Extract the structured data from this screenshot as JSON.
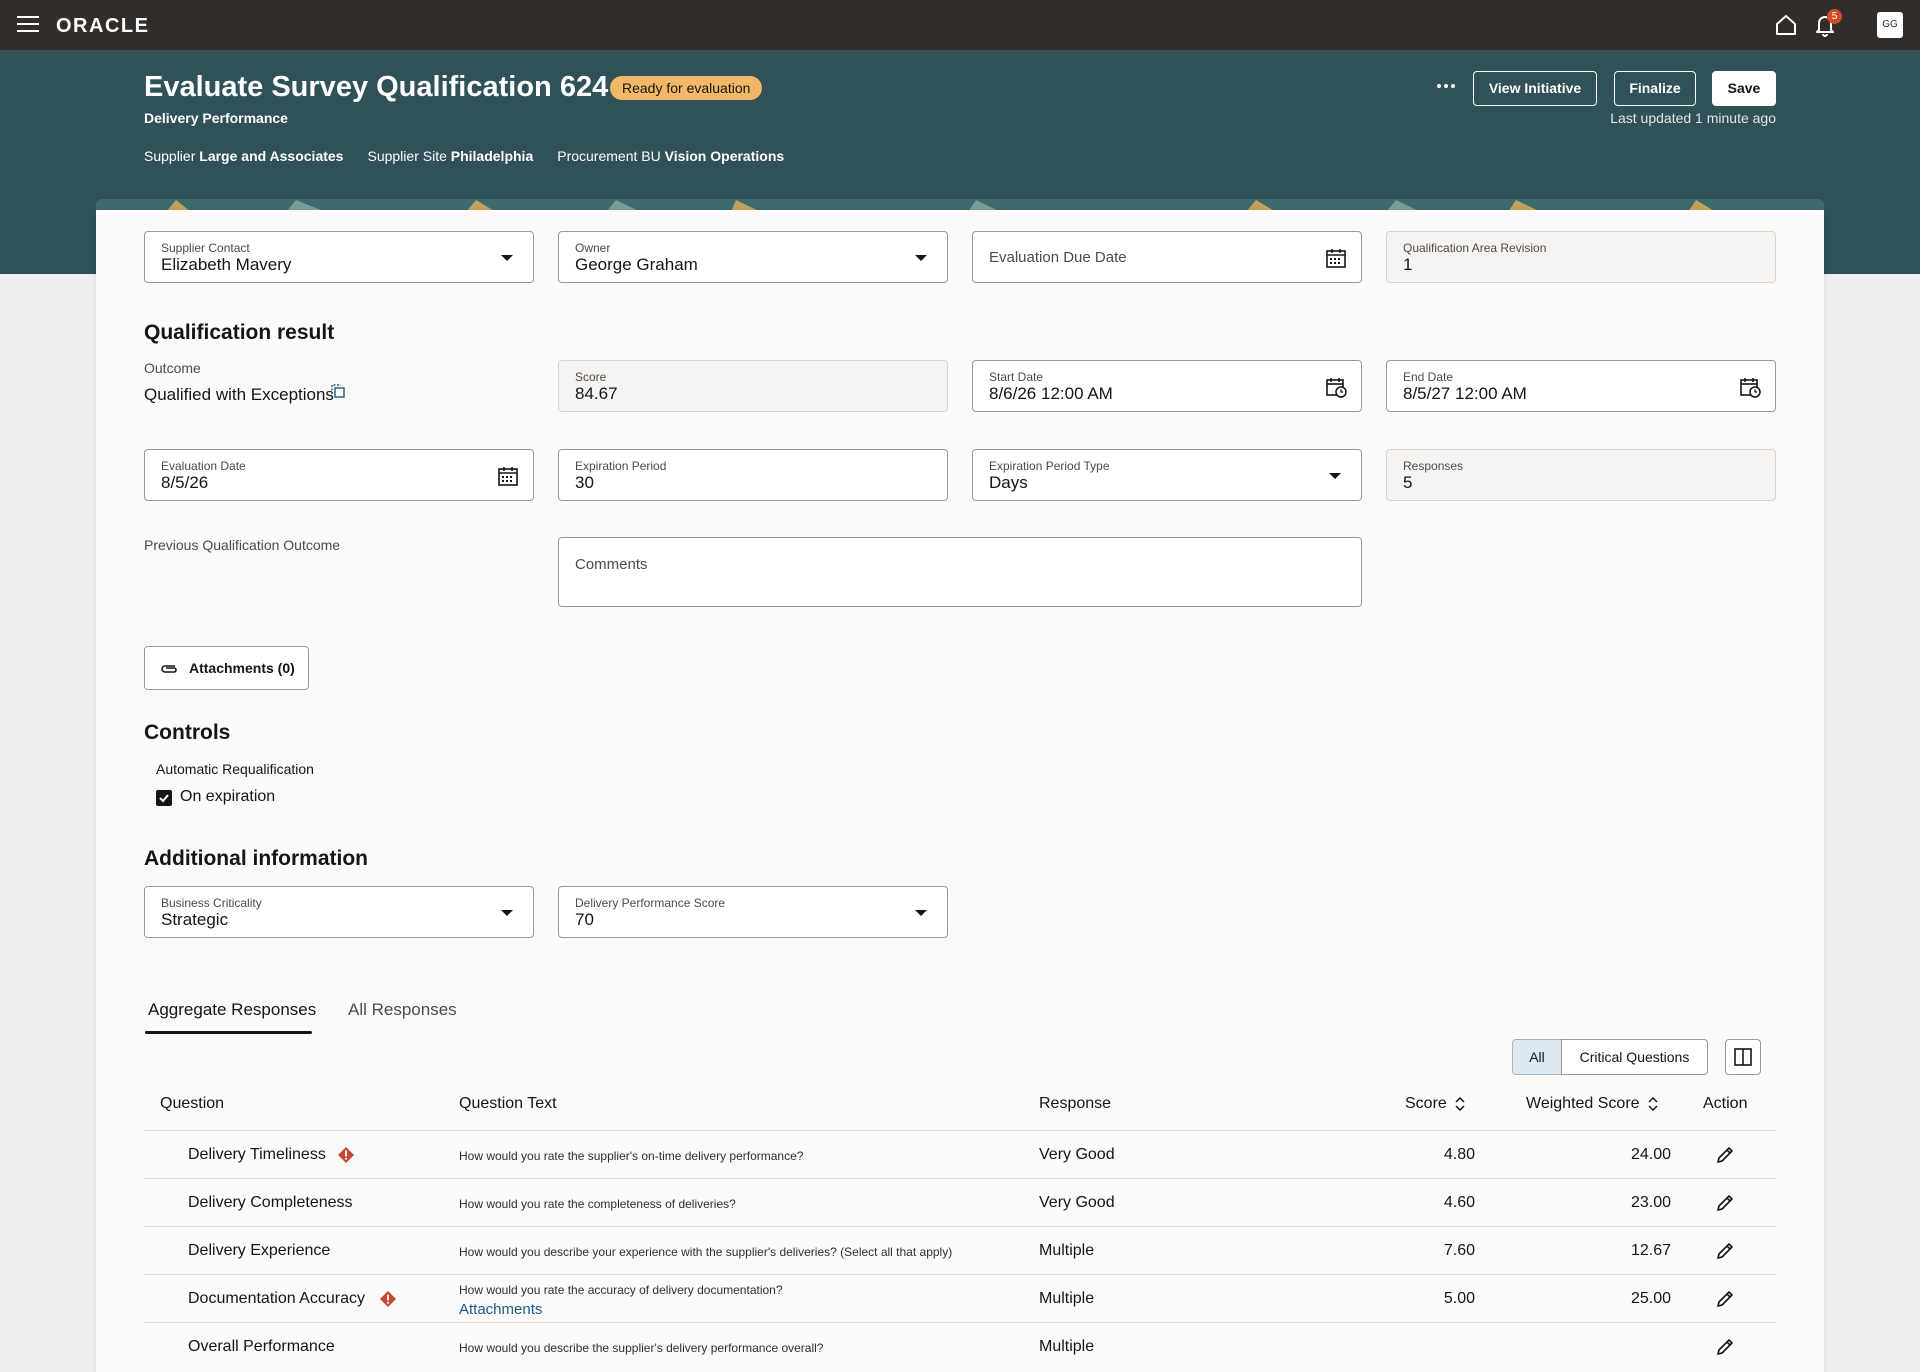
{
  "app": {
    "logo": "ORACLE",
    "notifications_count": "5",
    "user_initials": "GG"
  },
  "header": {
    "title": "Evaluate Survey Qualification 624",
    "status": "Ready for evaluation",
    "subtitle": "Delivery Performance",
    "supplier_label": "Supplier",
    "supplier_value": "Large and Associates",
    "site_label": "Supplier Site",
    "site_value": "Philadelphia",
    "bu_label": "Procurement BU",
    "bu_value": "Vision Operations",
    "view_initiative": "View Initiative",
    "finalize": "Finalize",
    "save": "Save",
    "last_updated": "Last updated 1 minute ago"
  },
  "top_fields": {
    "supplier_contact": {
      "label": "Supplier Contact",
      "value": "Elizabeth Mavery"
    },
    "owner": {
      "label": "Owner",
      "value": "George Graham"
    },
    "due_date": {
      "label": "Evaluation Due Date"
    },
    "revision": {
      "label": "Qualification Area Revision",
      "value": "1"
    }
  },
  "qualification": {
    "title": "Qualification result",
    "outcome_label": "Outcome",
    "outcome_value": "Qualified with Exceptions",
    "score": {
      "label": "Score",
      "value": "84.67"
    },
    "start_date": {
      "label": "Start Date",
      "value": "8/6/26 12:00 AM"
    },
    "end_date": {
      "label": "End Date",
      "value": "8/5/27 12:00 AM"
    },
    "evaluation_date": {
      "label": "Evaluation Date",
      "value": "8/5/26"
    },
    "expiration_period": {
      "label": "Expiration Period",
      "value": "30"
    },
    "expiration_type": {
      "label": "Expiration Period Type",
      "value": "Days"
    },
    "responses": {
      "label": "Responses",
      "value": "5"
    },
    "previous_outcome_label": "Previous Qualification Outcome",
    "comments_label": "Comments",
    "attachments": "Attachments (0)"
  },
  "controls": {
    "title": "Controls",
    "requal_label": "Automatic Requalification",
    "on_expiration": "On expiration",
    "on_expiration_checked": true
  },
  "additional": {
    "title": "Additional information",
    "criticality": {
      "label": "Business Criticality",
      "value": "Strategic"
    },
    "delivery_score": {
      "label": "Delivery Performance Score",
      "value": "70"
    }
  },
  "tabs": {
    "aggregate": "Aggregate Responses",
    "all": "All Responses"
  },
  "filter": {
    "all": "All",
    "critical": "Critical Questions"
  },
  "table": {
    "headers": {
      "question": "Question",
      "text": "Question Text",
      "response": "Response",
      "score": "Score",
      "weighted": "Weighted Score",
      "action": "Action"
    },
    "rows": [
      {
        "question": "Delivery Timeliness",
        "critical": true,
        "text": "How would you rate the supplier's on-time delivery performance?",
        "response": "Very Good",
        "score": "4.80",
        "weighted": "24.00"
      },
      {
        "question": "Delivery Completeness",
        "critical": false,
        "text": "How would you rate the completeness of deliveries?",
        "response": "Very Good",
        "score": "4.60",
        "weighted": "23.00"
      },
      {
        "question": "Delivery Experience",
        "critical": false,
        "text": "How would you describe your experience with the supplier's deliveries? (Select all that apply)",
        "response": "Multiple",
        "score": "7.60",
        "weighted": "12.67"
      },
      {
        "question": "Documentation Accuracy",
        "critical": true,
        "text": "How would you rate the accuracy of delivery documentation?",
        "link": "Attachments",
        "response": "Multiple",
        "score": "5.00",
        "weighted": "25.00"
      },
      {
        "question": "Overall Performance",
        "critical": false,
        "text": "How would you describe the supplier's delivery performance overall?",
        "response": "Multiple",
        "score": "",
        "weighted": ""
      }
    ]
  },
  "colors": {
    "topbar": "#312d2a",
    "header": "#2f5157",
    "badge": "#f2b868",
    "critical": "#c74634",
    "link": "#1d5b8a"
  }
}
